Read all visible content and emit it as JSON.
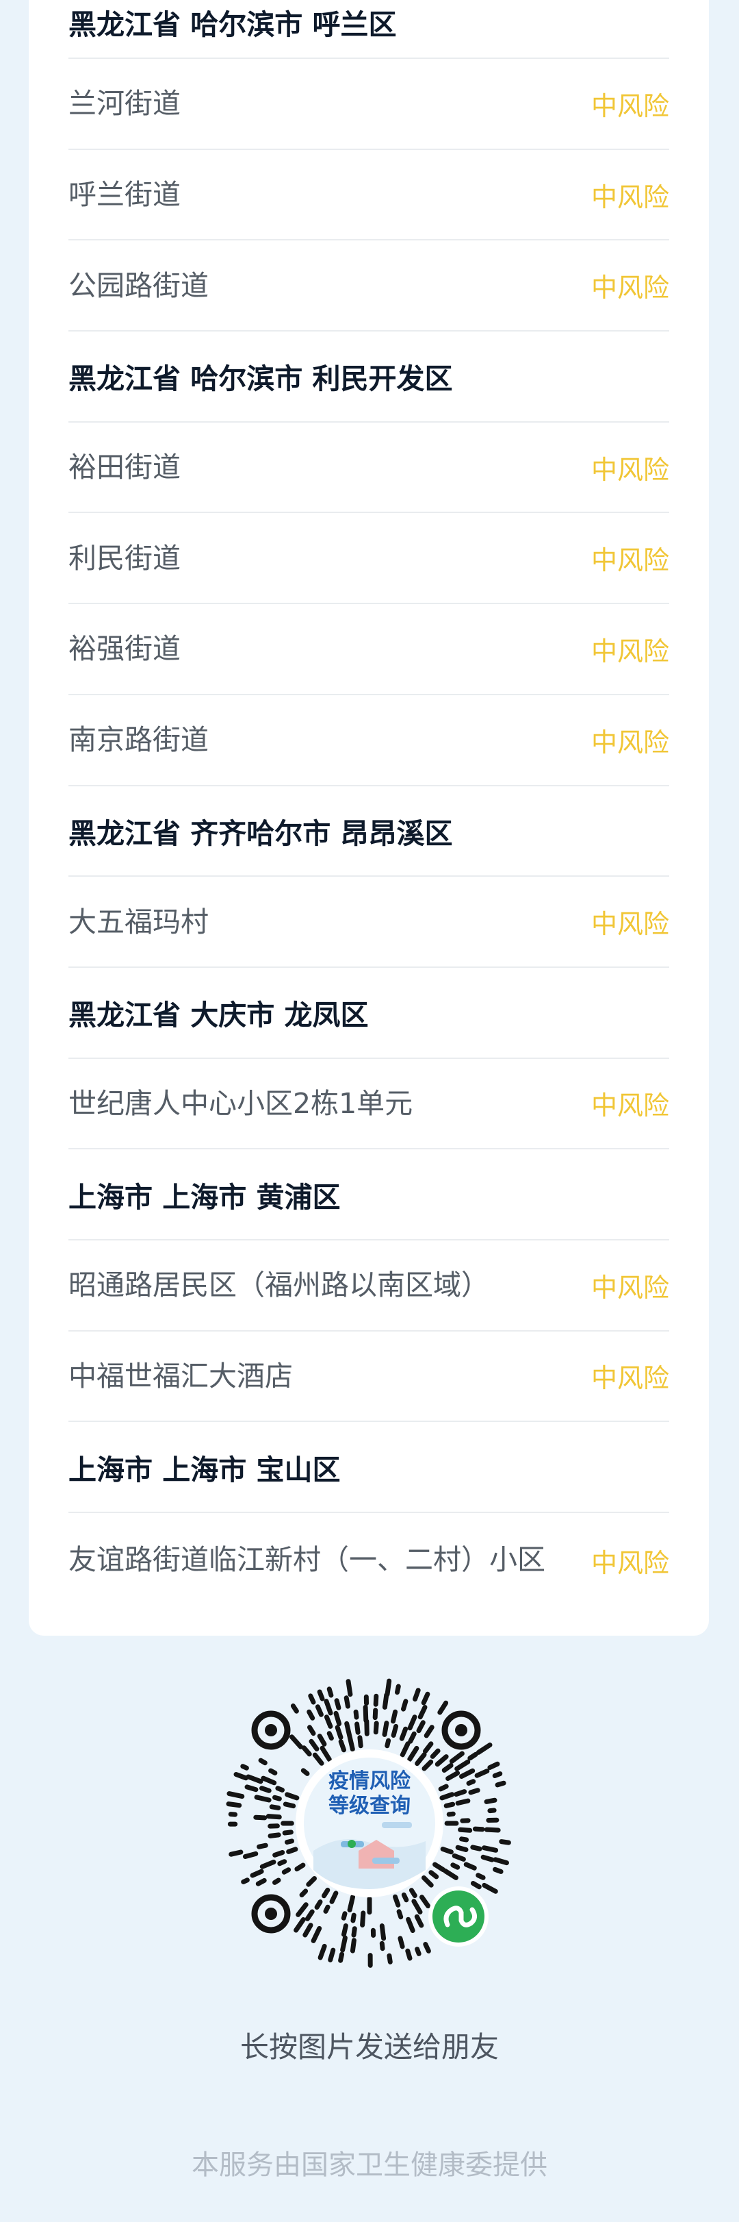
{
  "groups": [
    {
      "region": "黑龙江省 哈尔滨市 呼兰区",
      "items": [
        {
          "name": "兰河街道",
          "risk": "中风险"
        },
        {
          "name": "呼兰街道",
          "risk": "中风险"
        },
        {
          "name": "公园路街道",
          "risk": "中风险"
        }
      ]
    },
    {
      "region": "黑龙江省 哈尔滨市 利民开发区",
      "items": [
        {
          "name": "裕田街道",
          "risk": "中风险"
        },
        {
          "name": "利民街道",
          "risk": "中风险"
        },
        {
          "name": "裕强街道",
          "risk": "中风险"
        },
        {
          "name": "南京路街道",
          "risk": "中风险"
        }
      ]
    },
    {
      "region": "黑龙江省 齐齐哈尔市 昂昂溪区",
      "items": [
        {
          "name": "大五福玛村",
          "risk": "中风险"
        }
      ]
    },
    {
      "region": "黑龙江省 大庆市 龙凤区",
      "items": [
        {
          "name": "世纪唐人中心小区2栋1单元",
          "risk": "中风险"
        }
      ]
    },
    {
      "region": "上海市 上海市 黄浦区",
      "items": [
        {
          "name": "昭通路居民区（福州路以南区域）",
          "risk": "中风险"
        },
        {
          "name": "中福世福汇大酒店",
          "risk": "中风险"
        }
      ]
    },
    {
      "region": "上海市 上海市 宝山区",
      "items": [
        {
          "name": "友谊路街道临江新村（一、二村）小区",
          "risk": "中风险"
        }
      ]
    }
  ],
  "qr": {
    "center_line1": "疫情风险",
    "center_line2": "等级查询",
    "icon": "mini-program-icon"
  },
  "share_text": "长按图片发送给朋友",
  "footer_text": "本服务由国家卫生健康委提供",
  "colors": {
    "background": "#eaf3fa",
    "risk_medium": "#f1c636",
    "mini_program_green": "#2dae55"
  }
}
